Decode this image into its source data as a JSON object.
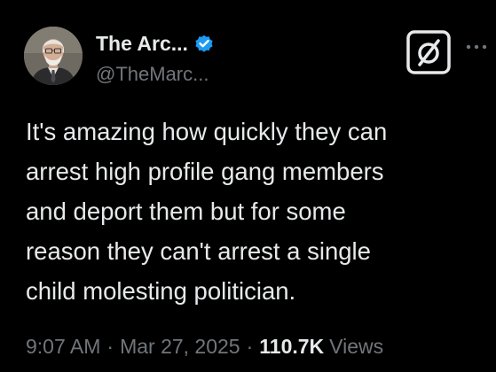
{
  "tweet": {
    "author": {
      "display_name": "The Arc...",
      "handle": "@TheMarc...",
      "verified": true,
      "avatar": "profile-photo"
    },
    "actions": {
      "grok_icon": "grok-icon",
      "more_icon": "more-options-icon"
    },
    "text_lines": [
      "It's amazing how quickly they can",
      "arrest high profile gang members",
      "and deport them but for some",
      "reason they can't arrest a single",
      "child molesting politician."
    ],
    "meta": {
      "time": "9:07 AM",
      "separator": "·",
      "date": "Mar 27, 2025",
      "views_count": "110.7K",
      "views_label": "Views"
    }
  },
  "colors": {
    "background": "#000000",
    "primary_text": "#e7e9ea",
    "secondary_text": "#71767b",
    "verified_blue": "#1d9bf0"
  }
}
